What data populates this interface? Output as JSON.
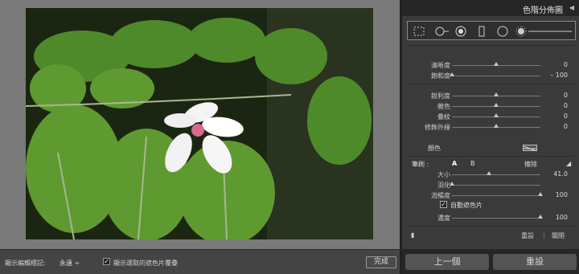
{
  "panel": {
    "title": "色階分佈圖",
    "sliders_top": [
      {
        "label": "清晰度",
        "value": "0",
        "pos": 0.5
      },
      {
        "label": "飽和度",
        "value": "– 100",
        "pos": 0.0
      }
    ],
    "sliders_mid": [
      {
        "label": "銳利度",
        "value": "0",
        "pos": 0.5
      },
      {
        "label": "雜色",
        "value": "0",
        "pos": 0.5
      },
      {
        "label": "疊紋",
        "value": "0",
        "pos": 0.5
      },
      {
        "label": "修飾外緣",
        "value": "0",
        "pos": 0.5
      }
    ],
    "color_label": "顏色",
    "brush": {
      "label": "筆刷 :",
      "a": "A",
      "b": "B",
      "erase": "擦除"
    },
    "brush_sliders": [
      {
        "label": "大小",
        "value": "41.0",
        "pos": 0.42
      },
      {
        "label": "羽化",
        "value": "",
        "pos": 0.0
      },
      {
        "label": "流暢度",
        "value": "100",
        "pos": 1.0
      }
    ],
    "auto_mask": {
      "label": "自動遮色片",
      "checked": "✓"
    },
    "density": {
      "label": "濃度",
      "value": "100",
      "pos": 1.0
    },
    "reset_label": "重設",
    "close_label": "關閉"
  },
  "nav": {
    "previous": "上一個",
    "reset": "重設"
  },
  "toolbar": {
    "show_pins_label": "顯示編輯標記:",
    "show_pins_value": "永遠 ÷",
    "overlay_check": "✓",
    "overlay_label": "顯示選取的遮色片覆疊",
    "done": "完成"
  }
}
